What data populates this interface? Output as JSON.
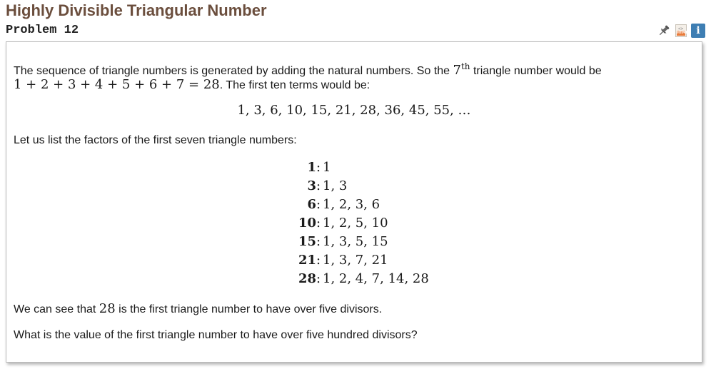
{
  "header": {
    "title": "Highly Divisible Triangular Number",
    "problem_label": "Problem 12",
    "icons": [
      "pin-icon",
      "html-icon",
      "info-icon"
    ],
    "html_icon_text": "HTML",
    "info_icon_text": "i"
  },
  "content": {
    "intro_part1": "The sequence of triangle numbers is generated by adding the natural numbers. So the ",
    "intro_ord_num": "7",
    "intro_ord_sup": "th",
    "intro_part2": " triangle number would be",
    "sum_expression": "1 + 2 + 3 + 4 + 5 + 6 + 7 = 28",
    "intro_part3": ". The first ten terms would be:",
    "sequence": "1, 3, 6, 10, 15, 21, 28, 36, 45, 55, …",
    "factors_intro": "Let us list the factors of the first seven triangle numbers:",
    "factors": [
      {
        "n": "1",
        "f": "1"
      },
      {
        "n": "3",
        "f": "1, 3"
      },
      {
        "n": "6",
        "f": "1, 2, 3, 6"
      },
      {
        "n": "10",
        "f": "1, 2, 5, 10"
      },
      {
        "n": "15",
        "f": "1, 3, 5, 15"
      },
      {
        "n": "21",
        "f": "1, 3, 7, 21"
      },
      {
        "n": "28",
        "f": "1, 2, 4, 7, 14, 28"
      }
    ],
    "conclusion_part1": "We can see that ",
    "conclusion_num": "28",
    "conclusion_part2": " is the first triangle number to have over five divisors.",
    "question": "What is the value of the first triangle number to have over five hundred divisors?"
  },
  "colors": {
    "title": "#6b4e3d",
    "info_icon_bg": "#3e7eb3",
    "html_icon_accent": "#e87c3c",
    "border": "#b9b9b9"
  }
}
